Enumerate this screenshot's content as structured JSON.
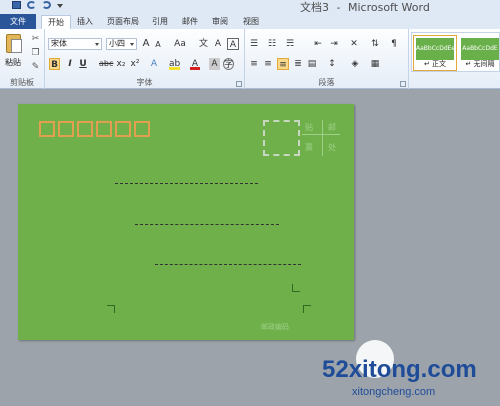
{
  "window": {
    "title": "文档3",
    "app_name": "Microsoft Word"
  },
  "tabs": {
    "file": "文件",
    "items": [
      "开始",
      "插入",
      "页面布局",
      "引用",
      "邮件",
      "审阅",
      "视图"
    ],
    "active": "开始"
  },
  "clipboard": {
    "paste_label": "粘贴",
    "group_label": "剪贴板"
  },
  "font": {
    "family": "宋体",
    "size": "小四",
    "group_label": "字体",
    "bold": "B",
    "italic": "I",
    "underline": "U",
    "strike": "abc",
    "sub": "x₂",
    "sup": "x²",
    "grow": "A",
    "shrink": "A",
    "change_case": "Aa",
    "clear": "A",
    "highlight": "ab",
    "color": "A",
    "char_border": "A"
  },
  "paragraph": {
    "group_label": "段落"
  },
  "styles": {
    "items": [
      {
        "sample": "AaBbCcDdEe",
        "name": "↵ 正文"
      },
      {
        "sample": "AaBbCcDdE",
        "name": "↵ 无间隔"
      }
    ]
  },
  "envelope": {
    "stamp_label_1": "贴",
    "stamp_label_2": "邮",
    "stamp_label_3": "票",
    "stamp_label_4": "处",
    "zip_caption": "邮政编码"
  },
  "watermark": {
    "main": "52xitong.com",
    "sub": "xitongcheng.com"
  },
  "colors": {
    "page": "#6fb04b",
    "accent": "#2a5699",
    "zip_box": "#e0a050"
  }
}
